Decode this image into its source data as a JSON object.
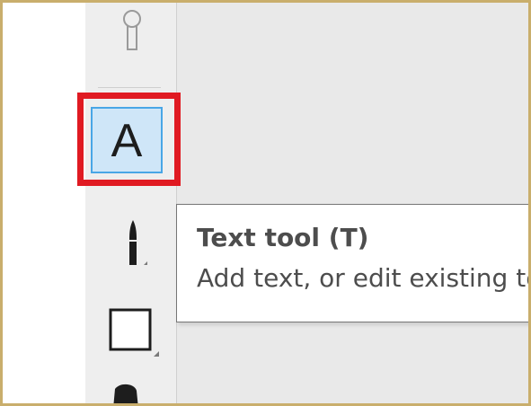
{
  "colors": {
    "frame_border": "#c9ae6c",
    "toolbar_bg": "#eeeeee",
    "canvas_bg": "#e9e9e9",
    "highlight": "#e01a22",
    "selected_tool_fill": "#cfe6f8",
    "selected_tool_border": "#49a6e6",
    "tooltip_text": "#4d4d4d"
  },
  "toolbar": {
    "tools": [
      {
        "icon": "pin-icon",
        "selected": false
      },
      {
        "icon": "text-tool-icon",
        "glyph": "A",
        "selected": true
      },
      {
        "icon": "brush-icon",
        "selected": false
      },
      {
        "icon": "rectangle-icon",
        "selected": false
      },
      {
        "icon": "fill-icon",
        "selected": false
      }
    ]
  },
  "tooltip": {
    "title": "Text tool (T)",
    "description": "Add text, or edit existing text"
  }
}
